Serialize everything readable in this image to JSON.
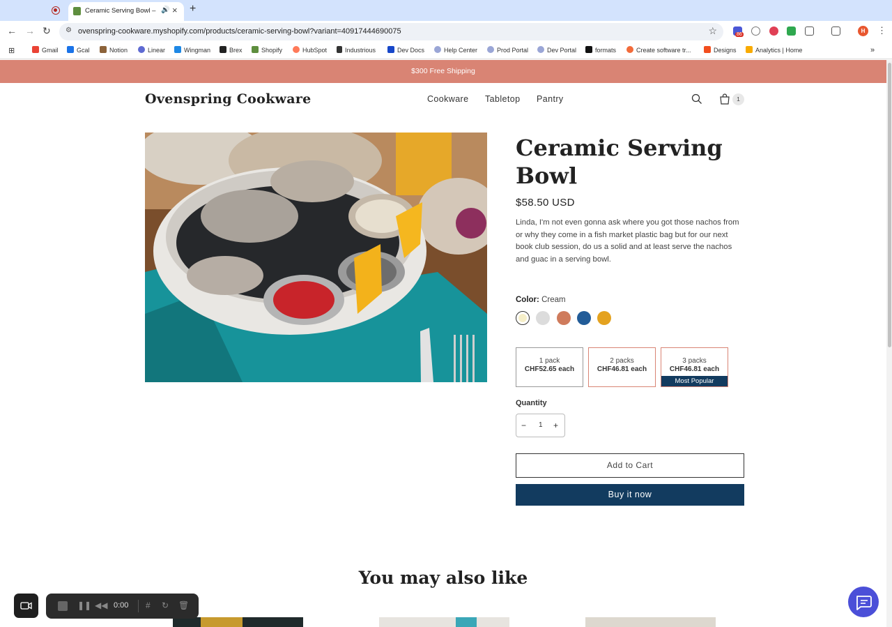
{
  "browser": {
    "tab_title": "Ceramic Serving Bowl – O",
    "url": "ovenspring-cookware.myshopify.com/products/ceramic-serving-bowl?variant=40917444690075",
    "bookmarks": [
      "Gmail",
      "Gcal",
      "Notion",
      "Linear",
      "Wingman",
      "Brex",
      "Shopify",
      "HubSpot",
      "Industrious",
      "Dev Docs",
      "Help Center",
      "Prod Portal",
      "Dev Portal",
      "formats",
      "Create software tr...",
      "Designs",
      "Analytics | Home"
    ],
    "profile_initial": "H",
    "ext_badge": "86"
  },
  "store": {
    "announcement": "$300 Free Shipping",
    "logo": "Ovenspring Cookware",
    "menu": [
      "Cookware",
      "Tabletop",
      "Pantry"
    ],
    "cart_count": "1"
  },
  "product": {
    "title": "Ceramic Serving Bowl",
    "price": "$58.50 USD",
    "description": "Linda, I'm not even gonna ask where you got those nachos from or why they come in a fish market plastic bag but for our next book club session, do us a solid and at least serve the nachos and guac in a serving bowl.",
    "color_label": "Color:",
    "color_value": "Cream",
    "swatches": [
      "#f6efc9",
      "#dcdcdc",
      "#cf7b5c",
      "#225c98",
      "#e4a21f"
    ],
    "packs": [
      {
        "title": "1 pack",
        "price": "CHF52.65 each",
        "badge": ""
      },
      {
        "title": "2 packs",
        "price": "CHF46.81 each",
        "badge": ""
      },
      {
        "title": "3 packs",
        "price": "CHF46.81 each",
        "badge": "Most Popular"
      }
    ],
    "quantity_label": "Quantity",
    "quantity": "1",
    "add_to_cart": "Add to Cart",
    "buy_now": "Buy it now"
  },
  "related": {
    "heading": "You may also like"
  },
  "recorder": {
    "time": "0:00"
  }
}
